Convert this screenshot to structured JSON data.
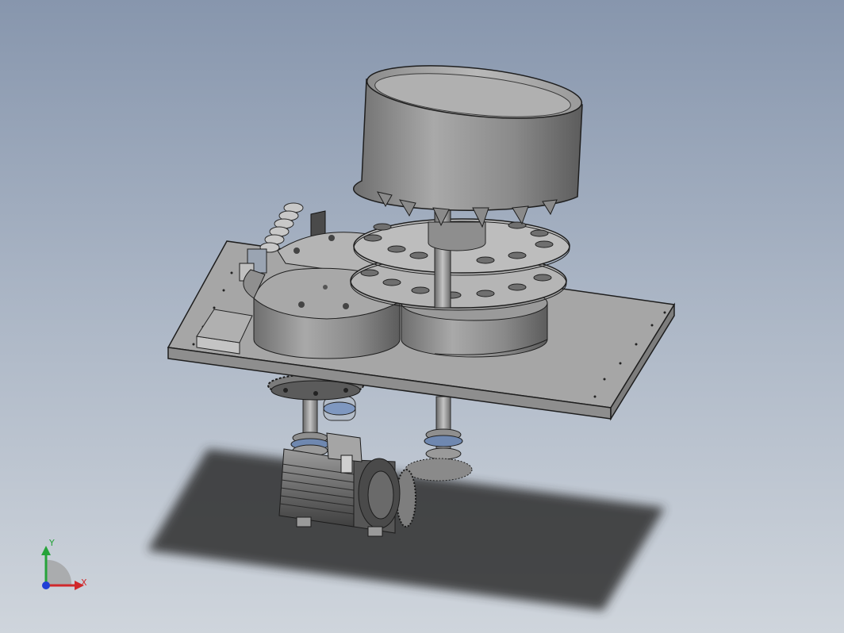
{
  "viewport": {
    "background_top": "#8796ad",
    "background_bottom": "#cfd5dc"
  },
  "triad": {
    "x_label": "X",
    "y_label": "Y",
    "x_color": "#d0282b",
    "y_color": "#26a33a",
    "z_color": "#1f3fd6"
  },
  "model": {
    "parts": [
      "hopper-drum",
      "upper-index-disc",
      "lower-index-disc",
      "star-wheel-left",
      "star-wheel-right",
      "base-plate",
      "bearing-shaft-left",
      "bearing-shaft-right",
      "servo-motor",
      "gear-train",
      "spring-feeder"
    ]
  }
}
